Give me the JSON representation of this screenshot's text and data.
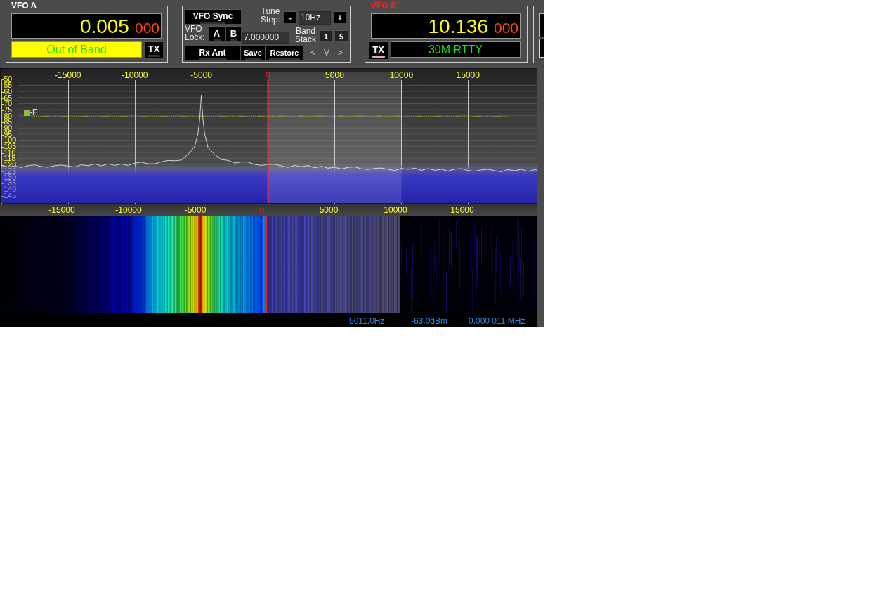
{
  "vfo_a": {
    "title": "VFO A",
    "frequency": "0.005",
    "frequency_sub": "000",
    "band": "Out of Band",
    "out_of_band": true,
    "tx_button": "TX",
    "tx_on": false
  },
  "controls": {
    "vfo_sync": {
      "label": "VFO Sync",
      "on": false
    },
    "tune_step_label": "Tune Step:",
    "step_down": "-",
    "tune_step": "10Hz",
    "step_up": "+",
    "vfo_lock_label": "VFO Lock:",
    "vfo_lock_buttons": [
      {
        "label": "A",
        "on": false
      },
      {
        "label": "B",
        "on": false
      }
    ],
    "frequency_field": "7.000000",
    "band_stack_label": "Band Stack",
    "band_stack_buttons": [
      "1",
      "5"
    ],
    "memory_buttons": [
      {
        "label": "Rx Ant",
        "on": false
      },
      {
        "label": "Save",
        "on": false
      },
      {
        "label": "Restore",
        "on": false
      }
    ],
    "nav_buttons": [
      "<",
      "V",
      ">"
    ]
  },
  "vfo_b": {
    "title": "VFO B",
    "frequency": "10.136",
    "frequency_sub": "000",
    "band": "30M RTTY",
    "out_of_band": false,
    "tx_button": "TX",
    "tx_on": true
  },
  "spectrum": {
    "chart_data": {
      "type": "line",
      "xlim": [
        -20100,
        20200
      ],
      "ylim": [
        -152,
        -41
      ],
      "grid": true,
      "xticks": [
        -15000,
        -10000,
        -5000,
        0,
        5000,
        10000,
        15000
      ],
      "yticks": [
        -50,
        -55,
        -60,
        -65,
        -70,
        -75,
        -80,
        -85,
        -90,
        -95,
        -100,
        -105,
        -110,
        -115,
        -120,
        -125,
        -130,
        -135,
        -140,
        -145
      ],
      "x": [
        -20000,
        -19500,
        -19000,
        -18500,
        -18000,
        -17500,
        -17000,
        -16500,
        -16000,
        -15500,
        -15000,
        -14500,
        -14000,
        -13500,
        -13000,
        -12500,
        -12000,
        -11500,
        -11000,
        -10500,
        -10000,
        -9500,
        -9000,
        -8500,
        -8000,
        -7500,
        -7000,
        -6500,
        -6000,
        -5500,
        -5250,
        -5125,
        -5000,
        -4875,
        -4750,
        -4500,
        -4000,
        -3500,
        -3000,
        -2500,
        -2000,
        -1500,
        -1000,
        -500,
        0,
        500,
        1000,
        1500,
        2000,
        2500,
        3000,
        3500,
        4000,
        4500,
        5000,
        5500,
        6000,
        6500,
        7000,
        7500,
        8000,
        8500,
        9000,
        9500,
        10000,
        10500,
        11000,
        11500,
        12000,
        12500,
        13000,
        13500,
        14000,
        14500,
        15000,
        15500,
        16000,
        16500,
        17000,
        17500,
        18000,
        18500,
        19000,
        19500,
        20000,
        20200
      ],
      "values": [
        -120.6,
        -122.0,
        -121.1,
        -122.3,
        -120.8,
        -120.2,
        -121.6,
        -122.1,
        -120.9,
        -120.3,
        -121.2,
        -122.0,
        -120.1,
        -120.8,
        -119.5,
        -121.0,
        -119.4,
        -120.6,
        -119.5,
        -120.6,
        -118.8,
        -118.0,
        -119.2,
        -119.3,
        -117.7,
        -116.6,
        -116.8,
        -116.3,
        -111.7,
        -105.3,
        -94.4,
        -83.1,
        -63.0,
        -83.4,
        -94.9,
        -105.9,
        -111.6,
        -115.9,
        -116.5,
        -118.7,
        -117.9,
        -117.9,
        -119.8,
        -120.6,
        -119.9,
        -119.7,
        -121.0,
        -122.2,
        -120.6,
        -121.7,
        -120.7,
        -122.6,
        -121.3,
        -122.9,
        -122.1,
        -123.6,
        -122.2,
        -121.8,
        -123.4,
        -124.0,
        -123.0,
        -122.7,
        -123.8,
        -124.8,
        -123.0,
        -123.9,
        -122.8,
        -124.6,
        -123.2,
        -124.6,
        -123.8,
        -125.2,
        -123.7,
        -123.2,
        -124.8,
        -125.3,
        -124.3,
        -123.8,
        -124.9,
        -125.8,
        -124.1,
        -124.9,
        -123.8,
        -125.5,
        -124.1,
        -124.6
      ],
      "bands": [
        {
          "axis": "y",
          "from": -152,
          "to": -121
        },
        {
          "axis": "x",
          "from": 0,
          "to": 10000
        }
      ],
      "ref_lines": [
        {
          "axis": "x",
          "value": 0,
          "color": "#ff2a2a"
        },
        {
          "axis": "y",
          "value": -80.7,
          "color": "#b8d040",
          "label": "-F"
        }
      ]
    }
  },
  "waterfall": {
    "freq_labels": [
      {
        "text": "-15000",
        "center": false
      },
      {
        "text": "-10000",
        "center": false
      },
      {
        "text": "-5000",
        "center": false
      },
      {
        "text": "0",
        "center": true
      },
      {
        "text": "5000",
        "center": false
      },
      {
        "text": "10000",
        "center": false
      },
      {
        "text": "15000",
        "center": false
      }
    ]
  },
  "status_bar": [
    "5011.0Hz",
    "-63.0dBm",
    "0.000 011 MHz"
  ]
}
